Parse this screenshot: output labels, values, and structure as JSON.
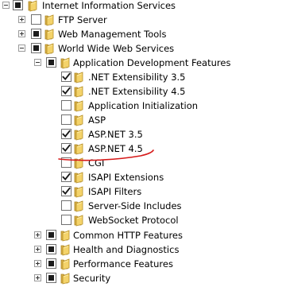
{
  "accent_underline_color": "#d61a1a",
  "tree": [
    {
      "key": "iis",
      "label": "Internet Information Services",
      "state": "indeterminate",
      "expander": "expanded"
    },
    {
      "key": "ftp",
      "label": "FTP Server",
      "state": "unchecked",
      "expander": "collapsed"
    },
    {
      "key": "wmt",
      "label": "Web Management Tools",
      "state": "indeterminate",
      "expander": "collapsed"
    },
    {
      "key": "www",
      "label": "World Wide Web Services",
      "state": "indeterminate",
      "expander": "expanded"
    },
    {
      "key": "adf",
      "label": "Application Development Features",
      "state": "indeterminate",
      "expander": "expanded"
    },
    {
      "key": "net35",
      "label": ".NET Extensibility 3.5",
      "state": "checked",
      "expander": "none"
    },
    {
      "key": "net45",
      "label": ".NET Extensibility 4.5",
      "state": "checked",
      "expander": "none"
    },
    {
      "key": "appinit",
      "label": "Application Initialization",
      "state": "unchecked",
      "expander": "none"
    },
    {
      "key": "asp",
      "label": "ASP",
      "state": "unchecked",
      "expander": "none"
    },
    {
      "key": "aspnet35",
      "label": "ASP.NET 3.5",
      "state": "checked",
      "expander": "none"
    },
    {
      "key": "aspnet45",
      "label": "ASP.NET 4.5",
      "state": "checked",
      "expander": "none",
      "highlight": "underline"
    },
    {
      "key": "cgi",
      "label": "CGI",
      "state": "unchecked",
      "expander": "none"
    },
    {
      "key": "isapiext",
      "label": "ISAPI Extensions",
      "state": "checked",
      "expander": "none"
    },
    {
      "key": "isapifil",
      "label": "ISAPI Filters",
      "state": "checked",
      "expander": "none"
    },
    {
      "key": "ssi",
      "label": "Server-Side Includes",
      "state": "unchecked",
      "expander": "none"
    },
    {
      "key": "websocket",
      "label": "WebSocket Protocol",
      "state": "unchecked",
      "expander": "none"
    },
    {
      "key": "chf",
      "label": "Common HTTP Features",
      "state": "indeterminate",
      "expander": "collapsed"
    },
    {
      "key": "hd",
      "label": "Health and Diagnostics",
      "state": "indeterminate",
      "expander": "collapsed"
    },
    {
      "key": "perf",
      "label": "Performance Features",
      "state": "indeterminate",
      "expander": "collapsed"
    },
    {
      "key": "sec",
      "label": "Security",
      "state": "indeterminate",
      "expander": "collapsed"
    }
  ]
}
